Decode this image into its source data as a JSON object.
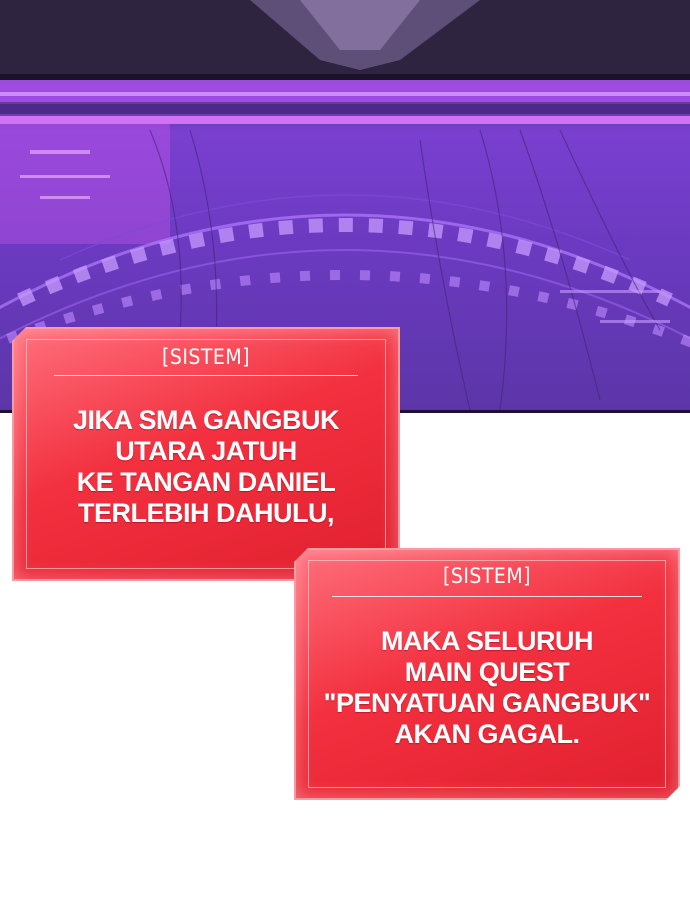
{
  "boxes": [
    {
      "label": "[SISTEM]",
      "lines": [
        "JIKA SMA GANGBUK",
        "UTARA JATUH",
        "KE TANGAN DANIEL",
        "TERLEBIH DAHULU,"
      ]
    },
    {
      "label": "[SISTEM]",
      "lines": [
        "MAKA SELURUH",
        "MAIN QUEST",
        "\"PENYATUAN GANGBUK\"",
        "AKAN GAGAL."
      ]
    }
  ],
  "colors": {
    "box_red": "#f2303f",
    "box_border": "#ff9aa3",
    "panel_purple": "#7a3fd0"
  }
}
